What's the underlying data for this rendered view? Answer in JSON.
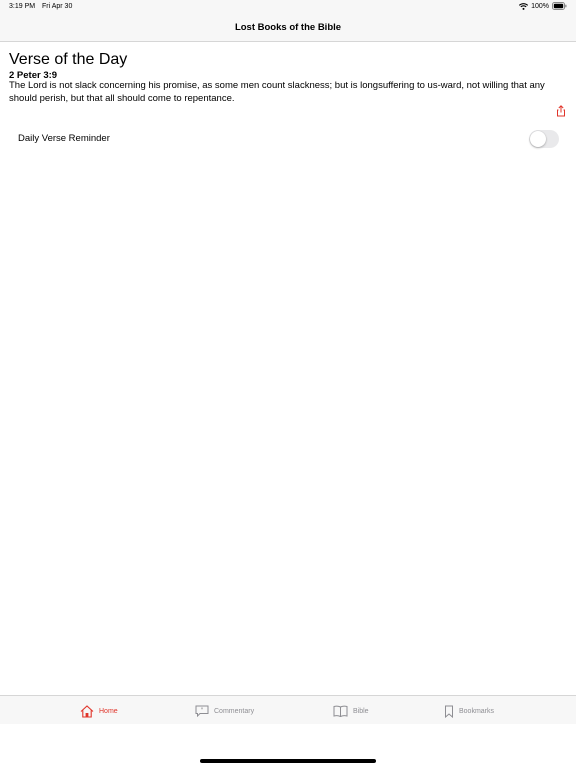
{
  "status_bar": {
    "time": "3:19 PM",
    "date": "Fri Apr 30",
    "battery": "100%",
    "icons": [
      "wifi-icon",
      "battery-icon"
    ]
  },
  "nav": {
    "title": "Lost Books of the Bible"
  },
  "verse_of_day": {
    "heading": "Verse of the Day",
    "reference": "2 Peter 3:9",
    "text": "The Lord is not slack concerning his promise, as some men count slackness; but is longsuffering to us-ward, not willing that any should perish, but that all should come to repentance.",
    "share_icon": "share-icon"
  },
  "reminder": {
    "label": "Daily Verse Reminder",
    "enabled": false
  },
  "tabs": [
    {
      "label": "Home",
      "icon": "home-icon",
      "active": true
    },
    {
      "label": "Commentary",
      "icon": "commentary-icon",
      "active": false
    },
    {
      "label": "Bible",
      "icon": "book-icon",
      "active": false
    },
    {
      "label": "Bookmarks",
      "icon": "bookmark-icon",
      "active": false
    }
  ],
  "colors": {
    "accent": "#e0342a",
    "inactive_tab": "#8e8e93",
    "bar_background": "#f7f7f7",
    "toggle_off": "#e9e9eb"
  }
}
